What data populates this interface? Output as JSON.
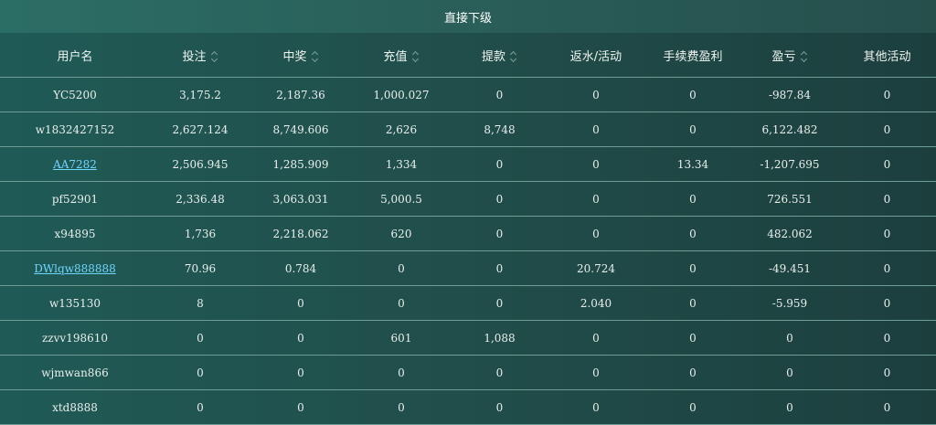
{
  "title": "直接下级",
  "columns": [
    {
      "label": "用户名",
      "sortable": false
    },
    {
      "label": "投注",
      "sortable": true
    },
    {
      "label": "中奖",
      "sortable": true
    },
    {
      "label": "充值",
      "sortable": true
    },
    {
      "label": "提款",
      "sortable": true
    },
    {
      "label": "返水/活动",
      "sortable": false
    },
    {
      "label": "手续费盈利",
      "sortable": false
    },
    {
      "label": "盈亏",
      "sortable": true
    },
    {
      "label": "其他活动",
      "sortable": false
    }
  ],
  "rows": [
    {
      "user": "YC5200",
      "link": false,
      "cells": [
        "3,175.2",
        "2,187.36",
        "1,000.027",
        "0",
        "0",
        "0",
        "-987.84",
        "0"
      ]
    },
    {
      "user": "w1832427152",
      "link": false,
      "cells": [
        "2,627.124",
        "8,749.606",
        "2,626",
        "8,748",
        "0",
        "0",
        "6,122.482",
        "0"
      ]
    },
    {
      "user": "AA7282",
      "link": true,
      "cells": [
        "2,506.945",
        "1,285.909",
        "1,334",
        "0",
        "0",
        "13.34",
        "-1,207.695",
        "0"
      ]
    },
    {
      "user": "pf52901",
      "link": false,
      "cells": [
        "2,336.48",
        "3,063.031",
        "5,000.5",
        "0",
        "0",
        "0",
        "726.551",
        "0"
      ]
    },
    {
      "user": "x94895",
      "link": false,
      "cells": [
        "1,736",
        "2,218.062",
        "620",
        "0",
        "0",
        "0",
        "482.062",
        "0"
      ]
    },
    {
      "user": "DWlqw888888",
      "link": true,
      "cells": [
        "70.96",
        "0.784",
        "0",
        "0",
        "20.724",
        "0",
        "-49.451",
        "0"
      ]
    },
    {
      "user": "w135130",
      "link": false,
      "cells": [
        "8",
        "0",
        "0",
        "0",
        "2.040",
        "0",
        "-5.959",
        "0"
      ]
    },
    {
      "user": "zzvv198610",
      "link": false,
      "cells": [
        "0",
        "0",
        "601",
        "1,088",
        "0",
        "0",
        "0",
        "0"
      ]
    },
    {
      "user": "wjmwan866",
      "link": false,
      "cells": [
        "0",
        "0",
        "0",
        "0",
        "0",
        "0",
        "0",
        "0"
      ]
    },
    {
      "user": "xtd8888",
      "link": false,
      "cells": [
        "0",
        "0",
        "0",
        "0",
        "0",
        "0",
        "0",
        "0"
      ]
    }
  ]
}
